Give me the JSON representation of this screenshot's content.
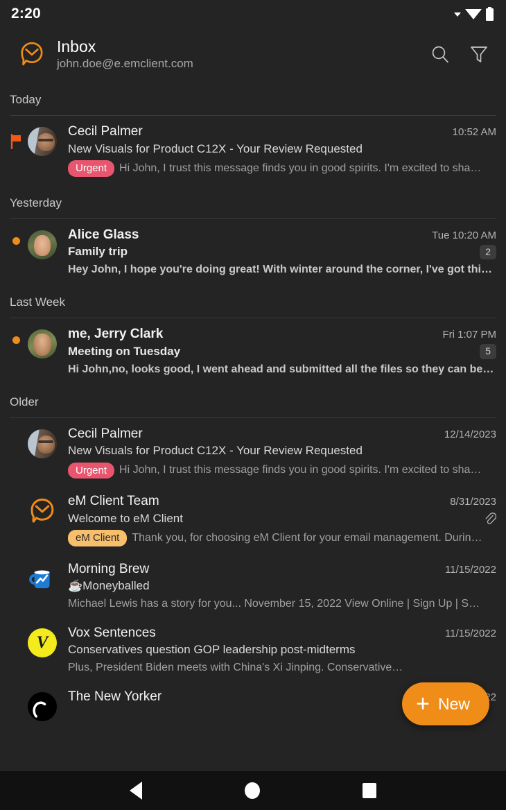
{
  "status_bar": {
    "time": "2:20",
    "icons": [
      "signal-triangle-icon",
      "wifi-icon",
      "battery-icon"
    ]
  },
  "header": {
    "logo_icon": "em-client-logo-icon",
    "title": "Inbox",
    "account": "john.doe@e.emclient.com",
    "search_icon": "search-icon",
    "filter_icon": "filter-icon"
  },
  "colors": {
    "accent_orange": "#F08C18",
    "tag_urgent": "#E8556E",
    "tag_emclient": "#F7BE6B",
    "background": "#242424",
    "navbar": "#111111"
  },
  "sections": [
    {
      "title": "Today",
      "rows": [
        {
          "flagged": true,
          "unread": false,
          "avatar": "cecil-palmer-photo",
          "sender": "Cecil Palmer",
          "date": "10:52 AM",
          "subject": "New Visuals for Product C12X - Your Review Requested",
          "count": "",
          "attachment": false,
          "tag": "Urgent",
          "tag_style": "urgent",
          "preview": "Hi John, I trust this message finds you in good spirits. I'm excited to sha…"
        }
      ]
    },
    {
      "title": "Yesterday",
      "rows": [
        {
          "flagged": false,
          "unread": true,
          "avatar": "alice-glass-photo",
          "sender": "Alice Glass",
          "date": "Tue 10:20 AM",
          "subject": "Family trip",
          "count": "2",
          "attachment": false,
          "tag": "",
          "tag_style": "",
          "preview": "Hey John, I hope you're doing great! With winter around the corner, I've got this …"
        }
      ]
    },
    {
      "title": "Last Week",
      "rows": [
        {
          "flagged": false,
          "unread": true,
          "avatar": "jerry-clark-photo",
          "sender": "me, Jerry Clark",
          "date": "Fri 1:07 PM",
          "subject": "Meeting on Tuesday",
          "count": "5",
          "attachment": false,
          "tag": "",
          "tag_style": "",
          "preview": "Hi John,no, looks good, I went ahead and submitted all the files so they can be …"
        }
      ]
    },
    {
      "title": "Older",
      "rows": [
        {
          "flagged": false,
          "unread": false,
          "avatar": "cecil-palmer-photo",
          "sender": "Cecil Palmer",
          "date": "12/14/2023",
          "subject": "New Visuals for Product C12X - Your Review Requested",
          "count": "",
          "attachment": false,
          "tag": "Urgent",
          "tag_style": "urgent",
          "preview": "Hi John, I trust this message finds you in good spirits. I'm excited to sha…"
        },
        {
          "flagged": false,
          "unread": false,
          "avatar": "em-client-logo-icon",
          "sender": "eM Client Team",
          "date": "8/31/2023",
          "subject": "Welcome to eM Client",
          "count": "",
          "attachment": true,
          "tag": "eM Client",
          "tag_style": "emclient",
          "preview": "Thank you, for choosing eM Client for your email management. Durin…"
        },
        {
          "flagged": false,
          "unread": false,
          "avatar": "morning-brew-mug-icon",
          "sender": "Morning Brew",
          "date": "11/15/2022",
          "subject": "☕Moneyballed",
          "count": "",
          "attachment": false,
          "tag": "",
          "tag_style": "",
          "preview": "Michael Lewis has a story for you... November 15, 2022 View Online | Sign Up | S…"
        },
        {
          "flagged": false,
          "unread": false,
          "avatar": "vox-sentences-logo",
          "sender": "Vox Sentences",
          "date": "11/15/2022",
          "subject": "Conservatives question GOP leadership post-midterms",
          "count": "",
          "attachment": false,
          "tag": "",
          "tag_style": "",
          "preview": "Plus, President Biden meets with China's Xi Jinping. Conservative…"
        },
        {
          "flagged": false,
          "unread": false,
          "avatar": "the-new-yorker-logo",
          "sender": "The New Yorker",
          "date": "11/14/2022",
          "subject": "",
          "count": "",
          "attachment": false,
          "tag": "",
          "tag_style": "",
          "preview": ""
        }
      ]
    }
  ],
  "fab": {
    "plus": "+",
    "label": "New"
  },
  "nav_bar": {
    "back_icon": "back-triangle-icon",
    "home_icon": "home-circle-icon",
    "recents_icon": "recents-square-icon"
  }
}
